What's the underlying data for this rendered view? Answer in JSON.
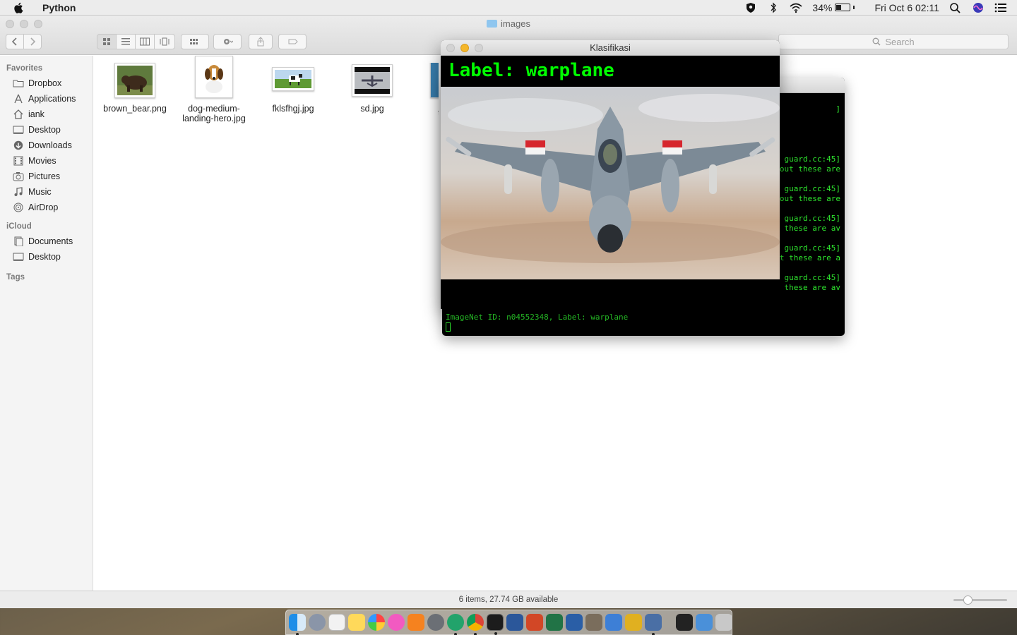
{
  "menubar": {
    "app_name": "Python",
    "battery_percent": "34%",
    "battery_level": 0.34,
    "datetime": "Fri Oct 6  02:11"
  },
  "finder": {
    "folder_name": "images",
    "search_placeholder": "Search",
    "sidebar": {
      "favorites_header": "Favorites",
      "favorites": [
        {
          "label": "Dropbox",
          "icon": "folder-icon"
        },
        {
          "label": "Applications",
          "icon": "applications-icon"
        },
        {
          "label": "iank",
          "icon": "home-icon"
        },
        {
          "label": "Desktop",
          "icon": "desktop-icon"
        },
        {
          "label": "Downloads",
          "icon": "downloads-icon"
        },
        {
          "label": "Movies",
          "icon": "movies-icon"
        },
        {
          "label": "Pictures",
          "icon": "pictures-icon"
        },
        {
          "label": "Music",
          "icon": "music-icon"
        },
        {
          "label": "AirDrop",
          "icon": "airdrop-icon"
        }
      ],
      "icloud_header": "iCloud",
      "icloud": [
        {
          "label": "Documents",
          "icon": "documents-icon"
        },
        {
          "label": "Desktop",
          "icon": "desktop-icon"
        }
      ],
      "tags_header": "Tags"
    },
    "files": [
      {
        "name": "brown_bear.png"
      },
      {
        "name": "dog-medium-landing-hero.jpg"
      },
      {
        "name": "fklsfhgj.jpg"
      },
      {
        "name": "sd.jpg"
      },
      {
        "name": "t"
      }
    ],
    "status": "6 items, 27.74 GB available"
  },
  "terminal": {
    "fragments": [
      "]",
      "guard.cc:45]",
      "out these are",
      "guard.cc:45]",
      "out these are",
      "guard.cc:45]",
      " these are av",
      "guard.cc:45]",
      "t these are a",
      "guard.cc:45]",
      " these are av"
    ],
    "last_line": "ImageNet ID: n04552348, Label: warplane"
  },
  "klasifikasi": {
    "title": "Klasifikasi",
    "label_text": "Label: warplane"
  },
  "colors": {
    "terminal_green": "#2ee62e",
    "label_green": "#00ff00",
    "close_red": "#d3d3d3",
    "minimize_yellow": "#f5b72a"
  }
}
